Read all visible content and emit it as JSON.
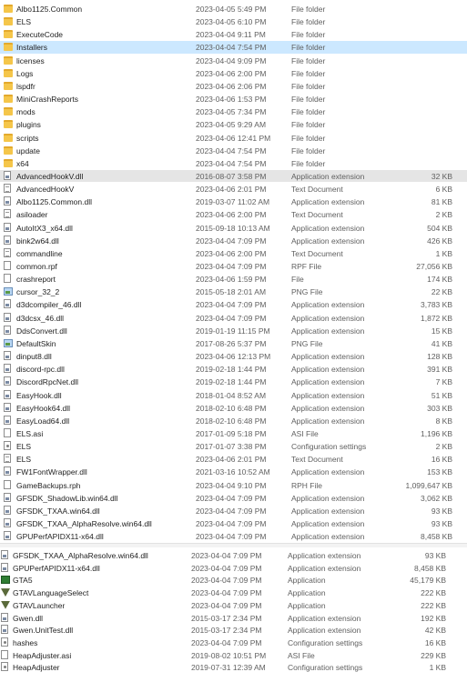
{
  "list1": [
    {
      "name": "Albo1125.Common",
      "date": "2023-04-05 5:49 PM",
      "type": "File folder",
      "size": "",
      "icon": "folder-icon"
    },
    {
      "name": "ELS",
      "date": "2023-04-05 6:10 PM",
      "type": "File folder",
      "size": "",
      "icon": "folder-icon"
    },
    {
      "name": "ExecuteCode",
      "date": "2023-04-04 9:11 PM",
      "type": "File folder",
      "size": "",
      "icon": "folder-icon"
    },
    {
      "name": "Installers",
      "date": "2023-04-04 7:54 PM",
      "type": "File folder",
      "size": "",
      "icon": "folder-icon",
      "state": "selected"
    },
    {
      "name": "licenses",
      "date": "2023-04-04 9:09 PM",
      "type": "File folder",
      "size": "",
      "icon": "folder-icon"
    },
    {
      "name": "Logs",
      "date": "2023-04-06 2:00 PM",
      "type": "File folder",
      "size": "",
      "icon": "folder-icon"
    },
    {
      "name": "lspdfr",
      "date": "2023-04-06 2:06 PM",
      "type": "File folder",
      "size": "",
      "icon": "folder-icon"
    },
    {
      "name": "MiniCrashReports",
      "date": "2023-04-06 1:53 PM",
      "type": "File folder",
      "size": "",
      "icon": "folder-icon"
    },
    {
      "name": "mods",
      "date": "2023-04-05 7:34 PM",
      "type": "File folder",
      "size": "",
      "icon": "folder-icon"
    },
    {
      "name": "plugins",
      "date": "2023-04-05 9:29 AM",
      "type": "File folder",
      "size": "",
      "icon": "folder-icon"
    },
    {
      "name": "scripts",
      "date": "2023-04-06 12:41 PM",
      "type": "File folder",
      "size": "",
      "icon": "folder-icon"
    },
    {
      "name": "update",
      "date": "2023-04-04 7:54 PM",
      "type": "File folder",
      "size": "",
      "icon": "folder-icon"
    },
    {
      "name": "x64",
      "date": "2023-04-04 7:54 PM",
      "type": "File folder",
      "size": "",
      "icon": "folder-icon"
    },
    {
      "name": "AdvancedHookV.dll",
      "date": "2016-08-07 3:58 PM",
      "type": "Application extension",
      "size": "32 KB",
      "icon": "dll-icon",
      "state": "hover"
    },
    {
      "name": "AdvancedHookV",
      "date": "2023-04-06 2:01 PM",
      "type": "Text Document",
      "size": "6 KB",
      "icon": "text-file-icon"
    },
    {
      "name": "Albo1125.Common.dll",
      "date": "2019-03-07 11:02 AM",
      "type": "Application extension",
      "size": "81 KB",
      "icon": "dll-icon"
    },
    {
      "name": "asiloader",
      "date": "2023-04-06 2:00 PM",
      "type": "Text Document",
      "size": "2 KB",
      "icon": "text-file-icon"
    },
    {
      "name": "AutoItX3_x64.dll",
      "date": "2015-09-18 10:13 AM",
      "type": "Application extension",
      "size": "504 KB",
      "icon": "dll-icon"
    },
    {
      "name": "bink2w64.dll",
      "date": "2023-04-04 7:09 PM",
      "type": "Application extension",
      "size": "426 KB",
      "icon": "dll-icon"
    },
    {
      "name": "commandline",
      "date": "2023-04-06 2:00 PM",
      "type": "Text Document",
      "size": "1 KB",
      "icon": "text-file-icon"
    },
    {
      "name": "common.rpf",
      "date": "2023-04-04 7:09 PM",
      "type": "RPF File",
      "size": "27,056 KB",
      "icon": "file-icon"
    },
    {
      "name": "crashreport",
      "date": "2023-04-06 1:59 PM",
      "type": "File",
      "size": "174 KB",
      "icon": "file-icon"
    },
    {
      "name": "cursor_32_2",
      "date": "2015-05-18 2:01 AM",
      "type": "PNG File",
      "size": "22 KB",
      "icon": "image-icon"
    },
    {
      "name": "d3dcompiler_46.dll",
      "date": "2023-04-04 7:09 PM",
      "type": "Application extension",
      "size": "3,783 KB",
      "icon": "dll-icon"
    },
    {
      "name": "d3dcsx_46.dll",
      "date": "2023-04-04 7:09 PM",
      "type": "Application extension",
      "size": "1,872 KB",
      "icon": "dll-icon"
    },
    {
      "name": "DdsConvert.dll",
      "date": "2019-01-19 11:15 PM",
      "type": "Application extension",
      "size": "15 KB",
      "icon": "dll-icon"
    },
    {
      "name": "DefaultSkin",
      "date": "2017-08-26 5:37 PM",
      "type": "PNG File",
      "size": "41 KB",
      "icon": "image-icon"
    },
    {
      "name": "dinput8.dll",
      "date": "2023-04-06 12:13 PM",
      "type": "Application extension",
      "size": "128 KB",
      "icon": "dll-icon"
    },
    {
      "name": "discord-rpc.dll",
      "date": "2019-02-18 1:44 PM",
      "type": "Application extension",
      "size": "391 KB",
      "icon": "dll-icon"
    },
    {
      "name": "DiscordRpcNet.dll",
      "date": "2019-02-18 1:44 PM",
      "type": "Application extension",
      "size": "7 KB",
      "icon": "dll-icon"
    },
    {
      "name": "EasyHook.dll",
      "date": "2018-01-04 8:52 AM",
      "type": "Application extension",
      "size": "51 KB",
      "icon": "dll-icon"
    },
    {
      "name": "EasyHook64.dll",
      "date": "2018-02-10 6:48 PM",
      "type": "Application extension",
      "size": "303 KB",
      "icon": "dll-icon"
    },
    {
      "name": "EasyLoad64.dll",
      "date": "2018-02-10 6:48 PM",
      "type": "Application extension",
      "size": "8 KB",
      "icon": "dll-icon"
    },
    {
      "name": "ELS.asi",
      "date": "2017-01-09 5:18 PM",
      "type": "ASI File",
      "size": "1,196 KB",
      "icon": "file-icon"
    },
    {
      "name": "ELS",
      "date": "2017-01-07 3:38 PM",
      "type": "Configuration settings",
      "size": "2 KB",
      "icon": "config-file-icon"
    },
    {
      "name": "ELS",
      "date": "2023-04-06 2:01 PM",
      "type": "Text Document",
      "size": "16 KB",
      "icon": "text-file-icon"
    },
    {
      "name": "FW1FontWrapper.dll",
      "date": "2021-03-16 10:52 AM",
      "type": "Application extension",
      "size": "153 KB",
      "icon": "dll-icon"
    },
    {
      "name": "GameBackups.rph",
      "date": "2023-04-04 9:10 PM",
      "type": "RPH File",
      "size": "1,099,647 KB",
      "icon": "file-icon"
    },
    {
      "name": "GFSDK_ShadowLib.win64.dll",
      "date": "2023-04-04 7:09 PM",
      "type": "Application extension",
      "size": "3,062 KB",
      "icon": "dll-icon"
    },
    {
      "name": "GFSDK_TXAA.win64.dll",
      "date": "2023-04-04 7:09 PM",
      "type": "Application extension",
      "size": "93 KB",
      "icon": "dll-icon"
    },
    {
      "name": "GFSDK_TXAA_AlphaResolve.win64.dll",
      "date": "2023-04-04 7:09 PM",
      "type": "Application extension",
      "size": "93 KB",
      "icon": "dll-icon"
    },
    {
      "name": "GPUPerfAPIDX11-x64.dll",
      "date": "2023-04-04 7:09 PM",
      "type": "Application extension",
      "size": "8,458 KB",
      "icon": "dll-icon"
    }
  ],
  "list2": [
    {
      "name": "GFSDK_TXAA_AlphaResolve.win64.dll",
      "date": "2023-04-04 7:09 PM",
      "type": "Application extension",
      "size": "93 KB",
      "icon": "dll-icon"
    },
    {
      "name": "GPUPerfAPIDX11-x64.dll",
      "date": "2023-04-04 7:09 PM",
      "type": "Application extension",
      "size": "8,458 KB",
      "icon": "dll-icon"
    },
    {
      "name": "GTA5",
      "date": "2023-04-04 7:09 PM",
      "type": "Application",
      "size": "45,179 KB",
      "icon": "gta-app-icon"
    },
    {
      "name": "GTAVLanguageSelect",
      "date": "2023-04-04 7:09 PM",
      "type": "Application",
      "size": "222 KB",
      "icon": "gtav-app-icon"
    },
    {
      "name": "GTAVLauncher",
      "date": "2023-04-04 7:09 PM",
      "type": "Application",
      "size": "222 KB",
      "icon": "gtav-app-icon"
    },
    {
      "name": "Gwen.dll",
      "date": "2015-03-17 2:34 PM",
      "type": "Application extension",
      "size": "192 KB",
      "icon": "dll-icon"
    },
    {
      "name": "Gwen.UnitTest.dll",
      "date": "2015-03-17 2:34 PM",
      "type": "Application extension",
      "size": "42 KB",
      "icon": "dll-icon"
    },
    {
      "name": "hashes",
      "date": "2023-04-04 7:09 PM",
      "type": "Configuration settings",
      "size": "16 KB",
      "icon": "config-file-icon"
    },
    {
      "name": "HeapAdjuster.asi",
      "date": "2019-08-02 10:51 PM",
      "type": "ASI File",
      "size": "229 KB",
      "icon": "file-icon"
    },
    {
      "name": "HeapAdjuster",
      "date": "2019-07-31 12:39 AM",
      "type": "Configuration settings",
      "size": "1 KB",
      "icon": "config-file-icon"
    }
  ]
}
